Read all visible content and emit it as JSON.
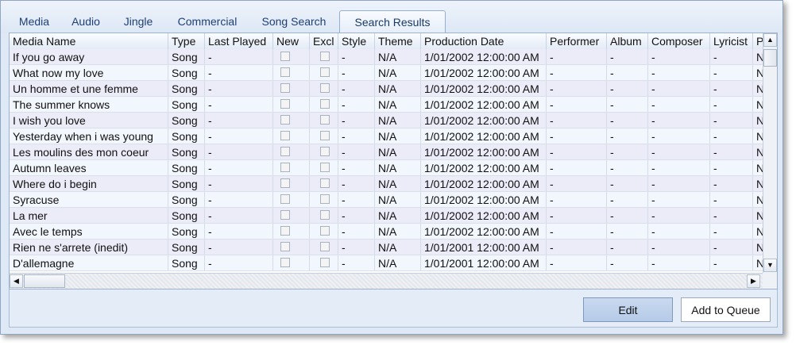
{
  "tabs": [
    {
      "label": "Media"
    },
    {
      "label": "Audio"
    },
    {
      "label": "Jingle"
    },
    {
      "label": "Commercial"
    },
    {
      "label": "Song Search"
    },
    {
      "label": "Search Results",
      "active": true
    }
  ],
  "grid": {
    "columns": [
      "Media Name",
      "Type",
      "Last Played",
      "New",
      "Excl",
      "Style",
      "Theme",
      "Production Date",
      "Performer",
      "Album",
      "Composer",
      "Lyricist",
      "P"
    ],
    "rows": [
      {
        "name": "If you go away",
        "type": "Song",
        "last": "-",
        "style": "-",
        "theme": "N/A",
        "date": "1/01/2002 12:00:00 AM",
        "performer": "-",
        "album": "-",
        "composer": "-",
        "lyricist": "-",
        "p": "N"
      },
      {
        "name": "What now my love",
        "type": "Song",
        "last": "-",
        "style": "-",
        "theme": "N/A",
        "date": "1/01/2002 12:00:00 AM",
        "performer": "-",
        "album": "-",
        "composer": "-",
        "lyricist": "-",
        "p": "N"
      },
      {
        "name": "Un homme et une femme",
        "type": "Song",
        "last": "-",
        "style": "-",
        "theme": "N/A",
        "date": "1/01/2002 12:00:00 AM",
        "performer": "-",
        "album": "-",
        "composer": "-",
        "lyricist": "-",
        "p": "N"
      },
      {
        "name": "The summer knows",
        "type": "Song",
        "last": "-",
        "style": "-",
        "theme": "N/A",
        "date": "1/01/2002 12:00:00 AM",
        "performer": "-",
        "album": "-",
        "composer": "-",
        "lyricist": "-",
        "p": "N"
      },
      {
        "name": "I wish you love",
        "type": "Song",
        "last": "-",
        "style": "-",
        "theme": "N/A",
        "date": "1/01/2002 12:00:00 AM",
        "performer": "-",
        "album": "-",
        "composer": "-",
        "lyricist": "-",
        "p": "N"
      },
      {
        "name": "Yesterday when i was young",
        "type": "Song",
        "last": "-",
        "style": "-",
        "theme": "N/A",
        "date": "1/01/2002 12:00:00 AM",
        "performer": "-",
        "album": "-",
        "composer": "-",
        "lyricist": "-",
        "p": "N"
      },
      {
        "name": "Les moulins des mon coeur",
        "type": "Song",
        "last": "-",
        "style": "-",
        "theme": "N/A",
        "date": "1/01/2002 12:00:00 AM",
        "performer": "-",
        "album": "-",
        "composer": "-",
        "lyricist": "-",
        "p": "N"
      },
      {
        "name": "Autumn leaves",
        "type": "Song",
        "last": "-",
        "style": "-",
        "theme": "N/A",
        "date": "1/01/2002 12:00:00 AM",
        "performer": "-",
        "album": "-",
        "composer": "-",
        "lyricist": "-",
        "p": "N"
      },
      {
        "name": "Where do i begin",
        "type": "Song",
        "last": "-",
        "style": "-",
        "theme": "N/A",
        "date": "1/01/2002 12:00:00 AM",
        "performer": "-",
        "album": "-",
        "composer": "-",
        "lyricist": "-",
        "p": "N"
      },
      {
        "name": "Syracuse",
        "type": "Song",
        "last": "-",
        "style": "-",
        "theme": "N/A",
        "date": "1/01/2002 12:00:00 AM",
        "performer": "-",
        "album": "-",
        "composer": "-",
        "lyricist": "-",
        "p": "N"
      },
      {
        "name": "La mer",
        "type": "Song",
        "last": "-",
        "style": "-",
        "theme": "N/A",
        "date": "1/01/2002 12:00:00 AM",
        "performer": "-",
        "album": "-",
        "composer": "-",
        "lyricist": "-",
        "p": "N"
      },
      {
        "name": "Avec le temps",
        "type": "Song",
        "last": "-",
        "style": "-",
        "theme": "N/A",
        "date": "1/01/2002 12:00:00 AM",
        "performer": "-",
        "album": "-",
        "composer": "-",
        "lyricist": "-",
        "p": "N"
      },
      {
        "name": "Rien ne s'arrete (inedit)",
        "type": "Song",
        "last": "-",
        "style": "-",
        "theme": "N/A",
        "date": "1/01/2001 12:00:00 AM",
        "performer": "-",
        "album": "-",
        "composer": "-",
        "lyricist": "-",
        "p": "N"
      },
      {
        "name": "D'allemagne",
        "type": "Song",
        "last": "-",
        "style": "-",
        "theme": "N/A",
        "date": "1/01/2001 12:00:00 AM",
        "performer": "-",
        "album": "-",
        "composer": "-",
        "lyricist": "-",
        "p": "N"
      }
    ]
  },
  "scroll": {
    "up_icon": "▲",
    "down_icon": "▼",
    "left_icon": "◀",
    "right_icon": "▶"
  },
  "buttons": {
    "edit_label": "Edit",
    "queue_label": "Add to Queue"
  },
  "colors": {
    "row_odd": "#ecebf8",
    "row_even": "#f2f6fd",
    "tab_text": "#1f3f73"
  }
}
